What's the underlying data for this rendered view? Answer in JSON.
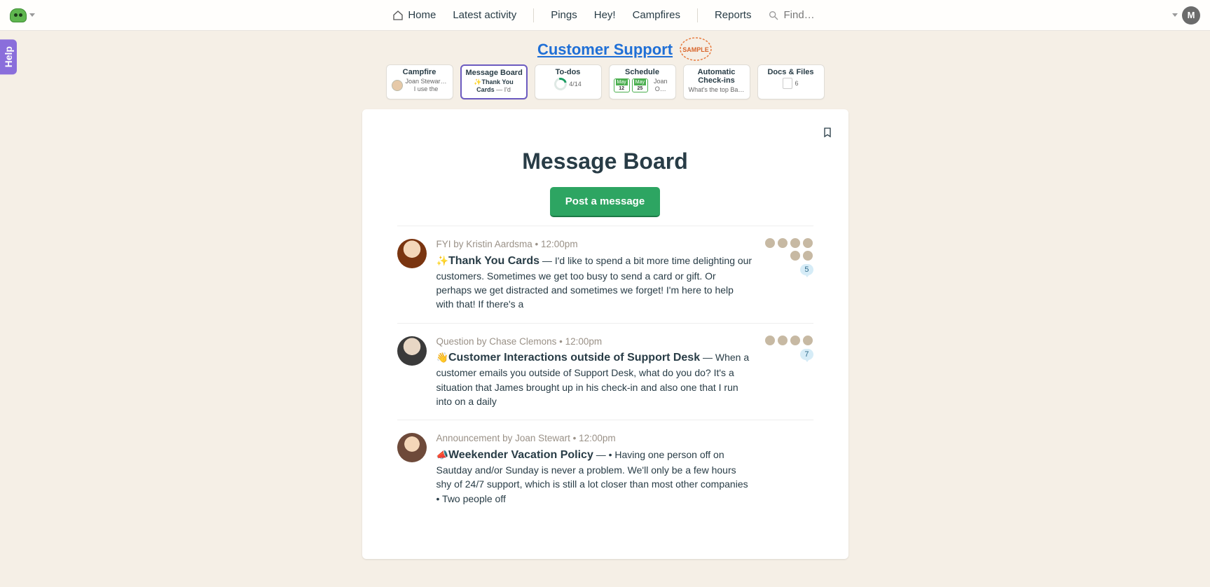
{
  "nav": {
    "home": "Home",
    "latest": "Latest activity",
    "pings": "Pings",
    "hey": "Hey!",
    "campfires": "Campfires",
    "reports": "Reports",
    "find": "Find…",
    "avatar_initial": "M"
  },
  "help_label": "Help",
  "project": {
    "name": "Customer Support",
    "badge": "SAMPLE"
  },
  "tabs": {
    "campfire": {
      "title": "Campfire",
      "sub_name": "Joan Stewar…",
      "sub_text": "I use the"
    },
    "message_board": {
      "title": "Message Board",
      "sub_emoji": "✨",
      "sub_title": "Thank You Cards",
      "sub_text": " — I'd"
    },
    "todos": {
      "title": "To-dos",
      "sub": "4/14"
    },
    "schedule": {
      "title": "Schedule",
      "month": "May",
      "d1": "12",
      "d2": "25",
      "name": "Joan O…"
    },
    "checkins": {
      "title": "Automatic Check-ins",
      "sub": "What's the top Ba…"
    },
    "docs": {
      "title": "Docs & Files",
      "count": "6"
    }
  },
  "page": {
    "title": "Message Board",
    "post_button": "Post a message"
  },
  "messages": [
    {
      "meta": "FYI by Kristin Aardsma • 12:00pm",
      "emoji": "✨",
      "title": "Thank You Cards",
      "excerpt": " — I'd like to spend a bit more time delighting our customers. Sometimes we get too busy to send a card or gift. Or perhaps we get distracted and sometimes we forget! I'm here to help with that! If there's a",
      "reply_count": "5",
      "participants": 6
    },
    {
      "meta": "Question by Chase Clemons • 12:00pm",
      "emoji": "👋",
      "title": "Customer Interactions outside of Support Desk",
      "excerpt": " — When a customer emails you outside of Support Desk, what do you do? It's a situation that James brought up in his check-in and also one that I run into on a daily",
      "reply_count": "7",
      "participants": 4
    },
    {
      "meta": "Announcement by Joan Stewart • 12:00pm",
      "emoji": "📣",
      "title": "Weekender Vacation Policy",
      "excerpt": " — • Having one person off on Sautday and/or Sunday is never a problem. We'll only be a few hours shy of 24/7 support, which is still a lot closer than most other companies • Two people off",
      "reply_count": "",
      "participants": 0
    }
  ]
}
